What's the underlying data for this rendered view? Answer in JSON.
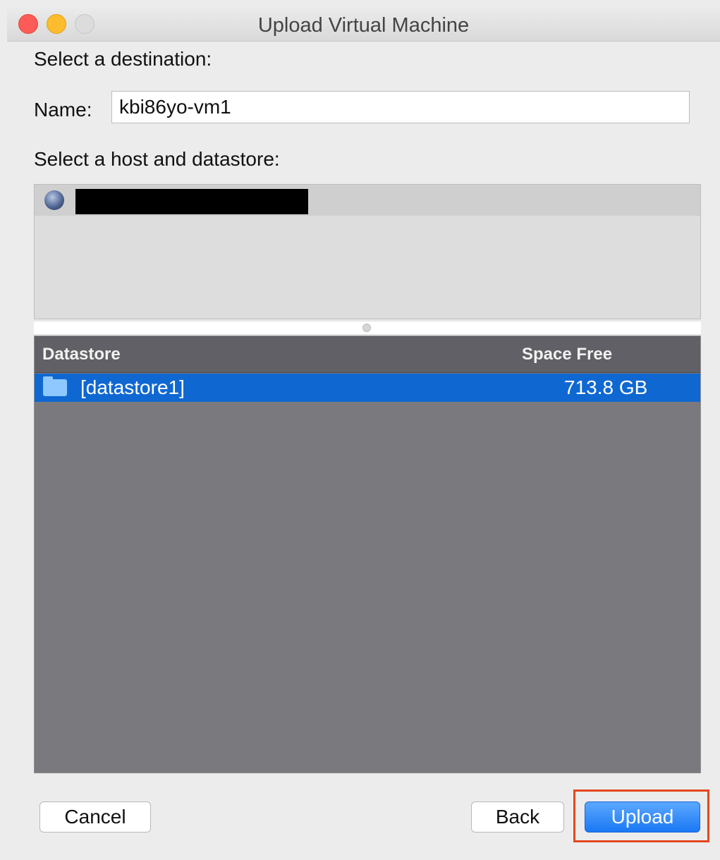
{
  "window": {
    "title": "Upload Virtual Machine"
  },
  "destination": {
    "heading": "Select a destination:",
    "name_label": "Name:",
    "name_value": "kbi86yo-vm1"
  },
  "host_section": {
    "heading": "Select a host and datastore:",
    "host_icon": "globe-icon"
  },
  "datastore_table": {
    "columns": [
      "Datastore",
      "Space Free"
    ],
    "rows": [
      {
        "name": "[datastore1]",
        "space_free": "713.8 GB",
        "selected": true,
        "icon": "folder-icon"
      }
    ]
  },
  "buttons": {
    "cancel": "Cancel",
    "back": "Back",
    "upload": "Upload"
  },
  "colors": {
    "selection": "#0f68d2",
    "primary_button": "#1a78f4",
    "highlight_box": "#e4471f"
  }
}
